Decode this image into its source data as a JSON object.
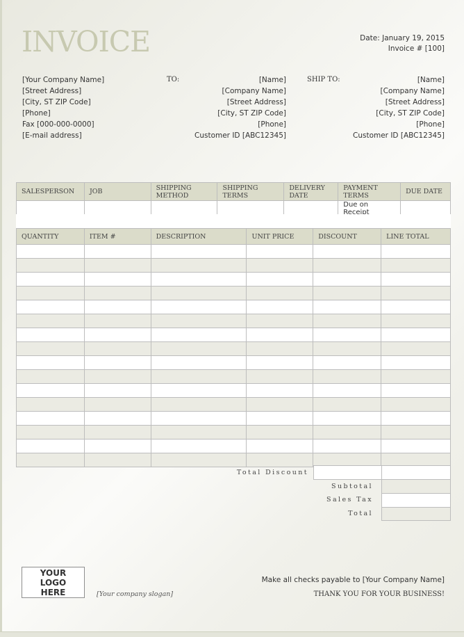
{
  "header": {
    "title": "INVOICE",
    "date": "Date: January 19, 2015",
    "invoice_number": "Invoice # [100]"
  },
  "from": {
    "lines": [
      "[Your Company Name]",
      "[Street Address]",
      "[City, ST  ZIP Code]",
      "[Phone]",
      "Fax [000-000-0000]",
      "[E-mail address]"
    ]
  },
  "bill_to": {
    "label": "TO:",
    "lines": [
      "[Name]",
      "[Company Name]",
      "[Street Address]",
      "[City, ST  ZIP Code]",
      "[Phone]",
      "Customer ID [ABC12345]"
    ]
  },
  "ship_to": {
    "label": "SHIP TO:",
    "lines": [
      "[Name]",
      "[Company Name]",
      "[Street Address]",
      "[City, ST  ZIP Code]",
      "[Phone]",
      "Customer ID [ABC12345]"
    ]
  },
  "info_table": {
    "headers": [
      "SALESPERSON",
      "JOB",
      "SHIPPING METHOD",
      "SHIPPING TERMS",
      "DELIVERY DATE",
      "PAYMENT TERMS",
      "DUE DATE"
    ],
    "values": [
      "",
      "",
      "",
      "",
      "",
      "Due on Receipt",
      ""
    ]
  },
  "items_table": {
    "headers": [
      "QUANTITY",
      "ITEM #",
      "DESCRIPTION",
      "UNIT PRICE",
      "DISCOUNT",
      "LINE TOTAL"
    ],
    "row_count": 16
  },
  "totals": {
    "total_discount": "Total Discount",
    "subtotal": "Subtotal",
    "sales_tax": "Sales Tax",
    "total": "Total"
  },
  "footer": {
    "logo": "YOUR LOGO HERE",
    "slogan": "[Your company slogan]",
    "payable": "Make all checks payable to [Your Company Name]",
    "thanks": "THANK YOU FOR YOUR BUSINESS!"
  },
  "colors": {
    "title": "#c7c9b0",
    "header_fill": "#dbdcca",
    "row_shade": "#ebebe3"
  }
}
